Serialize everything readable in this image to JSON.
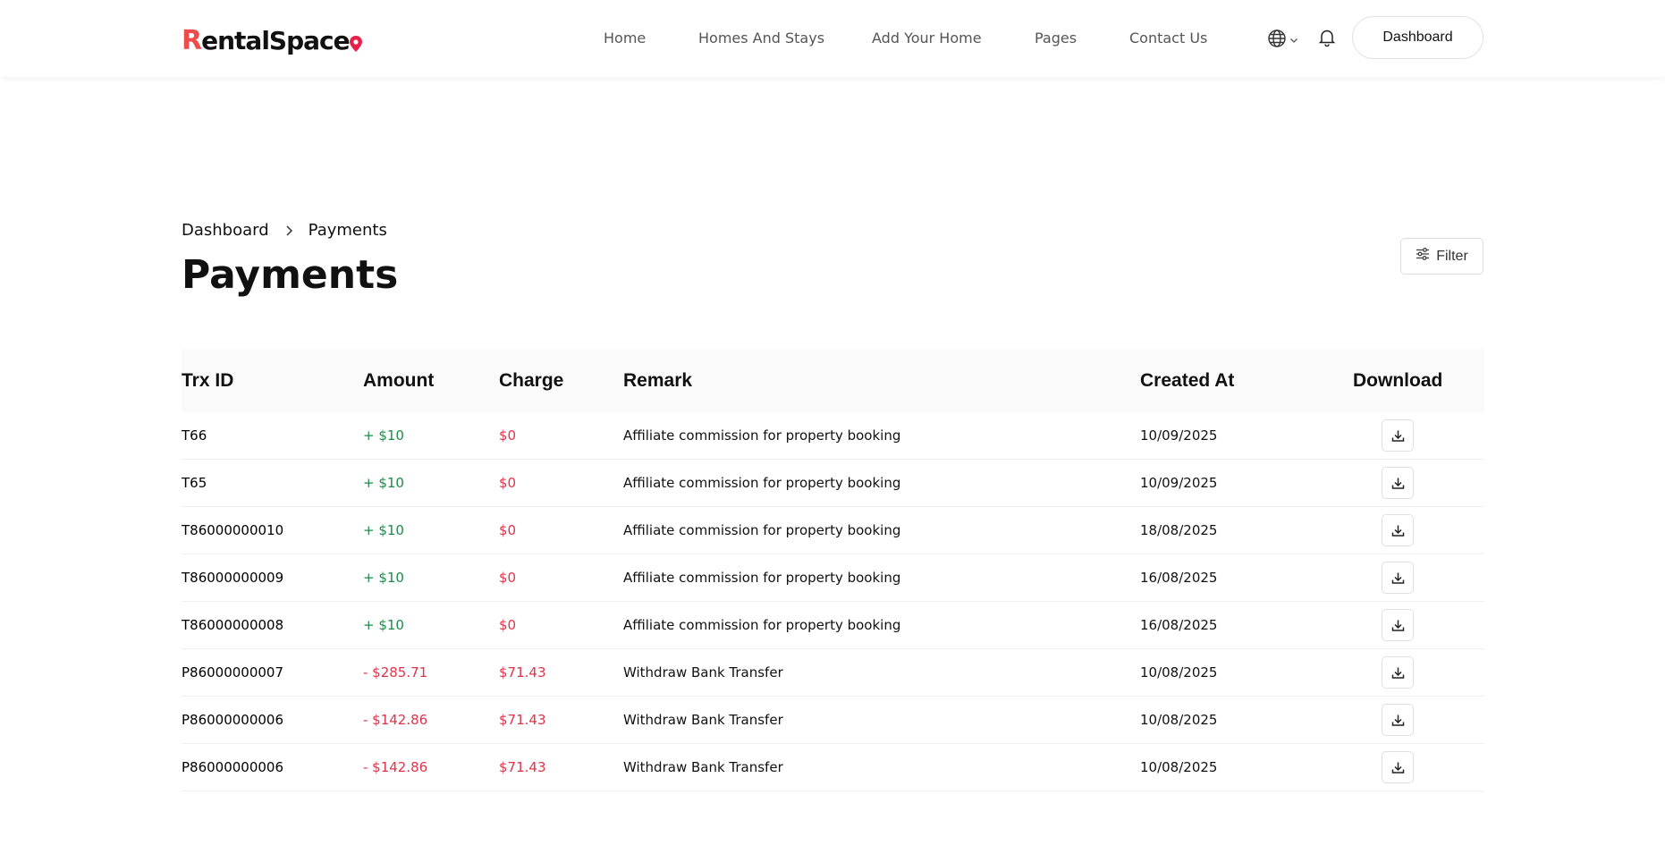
{
  "brand": {
    "logo_initial": "R",
    "logo_rest": "entalSpac",
    "logo_tail": "e",
    "accent": "#ef4b4b"
  },
  "nav": {
    "items": [
      "Home",
      "Homes And Stays",
      "Add Your Home",
      "Pages",
      "Contact Us"
    ],
    "dashboard_button": "Dashboard"
  },
  "breadcrumb": {
    "root": "Dashboard",
    "current": "Payments"
  },
  "page": {
    "title": "Payments",
    "filter_label": "Filter"
  },
  "table": {
    "headers": {
      "trx": "Trx ID",
      "amount": "Amount",
      "charge": "Charge",
      "remark": "Remark",
      "created": "Created At",
      "download": "Download"
    },
    "rows": [
      {
        "trx": "T66",
        "amount": "+ $10",
        "charge": "$0",
        "remark": "Affiliate commission for property booking",
        "created": "10/09/2025"
      },
      {
        "trx": "T65",
        "amount": "+ $10",
        "charge": "$0",
        "remark": "Affiliate commission for property booking",
        "created": "10/09/2025"
      },
      {
        "trx": "T86000000010",
        "amount": "+ $10",
        "charge": "$0",
        "remark": "Affiliate commission for property booking",
        "created": "18/08/2025"
      },
      {
        "trx": "T86000000009",
        "amount": "+ $10",
        "charge": "$0",
        "remark": "Affiliate commission for property booking",
        "created": "16/08/2025"
      },
      {
        "trx": "T86000000008",
        "amount": "+ $10",
        "charge": "$0",
        "remark": "Affiliate commission for property booking",
        "created": "16/08/2025"
      },
      {
        "trx": "P86000000007",
        "amount": "- $285.71",
        "charge": "$71.43",
        "remark": "Withdraw Bank Transfer",
        "created": "10/08/2025"
      },
      {
        "trx": "P86000000006",
        "amount": "- $142.86",
        "charge": "$71.43",
        "remark": "Withdraw Bank Transfer",
        "created": "10/08/2025"
      },
      {
        "trx": "P86000000006",
        "amount": "- $142.86",
        "charge": "$71.43",
        "remark": "Withdraw Bank Transfer",
        "created": "10/08/2025"
      }
    ]
  },
  "colors": {
    "credit": "#1e8a4a",
    "debit": "#e0334a",
    "charge": "#e0334a"
  },
  "icons": [
    "globe-icon",
    "chevron-down-icon",
    "bell-icon",
    "chevron-right-icon",
    "filter-sliders-icon",
    "download-icon",
    "location-pin-icon"
  ]
}
